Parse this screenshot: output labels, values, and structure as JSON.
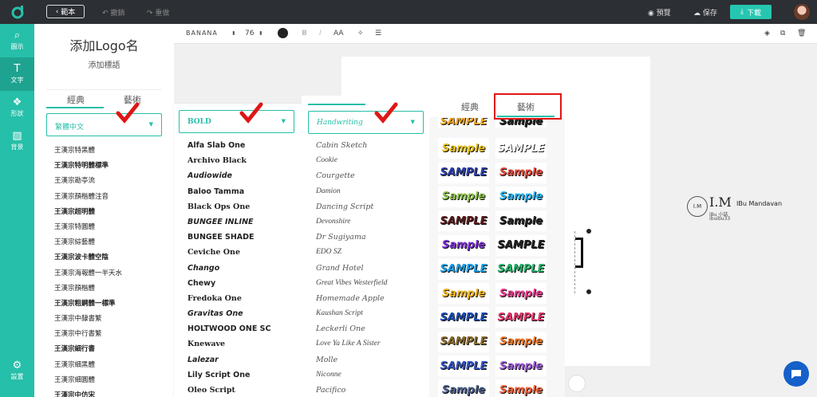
{
  "topbar": {
    "back_label": "範本",
    "undo_label": "撤銷",
    "redo_label": "重做",
    "preview_label": "預覽",
    "save_label": "保存",
    "download_label": "下載"
  },
  "sidebar": {
    "items": [
      {
        "label": "圖示",
        "icon": "search-icon"
      },
      {
        "label": "文字",
        "icon": "text-icon"
      },
      {
        "label": "形狀",
        "icon": "shapes-icon"
      },
      {
        "label": "背景",
        "icon": "pattern-icon"
      },
      {
        "label": "設置",
        "icon": "gear-icon"
      }
    ]
  },
  "text_panel": {
    "title": "添加Logo名",
    "subtitle": "添加標語",
    "tabs": [
      "經典",
      "藝術"
    ],
    "select_value": "繁體中文",
    "fonts": [
      "王漢宗特黑體",
      "王漢宗特明體標準",
      "王漢宗勘亭流",
      "王漢宗顏楷體注音",
      "王漢宗超明體",
      "王漢宗特圓體",
      "王漢宗綜藝體",
      "王漢宗波卡體空陰",
      "王漢宗海報體一半天水",
      "王漢宗顏楷體",
      "王漢宗粗鋼體一標準",
      "王漢宗中隸書繁",
      "王漢宗中行書繁",
      "王漢宗細行書",
      "王漢宗細黑體",
      "王漢宗細圓體",
      "王漢宗中仿宋"
    ]
  },
  "toolbar": {
    "font_name": "BANANA",
    "font_size": "76",
    "bold": "B",
    "italic": "I",
    "case": "AA"
  },
  "panel_bold": {
    "select_value": "BOLD",
    "fonts": [
      "Alfa Slab One",
      "Archivo Black",
      "Audiowide",
      "Baloo Tamma",
      "Black Ops One",
      "BUNGEE INLINE",
      "BUNGEE SHADE",
      "Ceviche One",
      "Chango",
      "Chewy",
      "Fredoka One",
      "Gravitas One",
      "HOLTWOOD ONE SC",
      "Knewave",
      "Lalezar",
      "Lily Script One",
      "Oleo Script"
    ]
  },
  "panel_hand": {
    "select_value": "Handwriting",
    "fonts": [
      "Cabin Sketch",
      "Cookie",
      "Courgette",
      "Damion",
      "Dancing Script",
      "Devonshire",
      "Dr Sugiyama",
      "EDO SZ",
      "Grand Hotel",
      "Great Vibes Westerfield",
      "Homemade Apple",
      "Kaushan Script",
      "Leckerli One",
      "Love Ya Like A Sister",
      "Molle",
      "Niconne",
      "Pacifico"
    ]
  },
  "panel_art": {
    "tabs": [
      "經典",
      "藝術"
    ],
    "sample_text": "Sample",
    "sample_text_upper": "SAMPLE"
  },
  "watermark": {
    "initials": "I.M",
    "name": "IBu Mandavan",
    "line1": "iBu 小誌",
    "line2": "ibuibu33"
  },
  "colors": {
    "accent": "#26bfa9",
    "topbar": "#2c2f33",
    "highlight": "#e01515",
    "chat": "#1560c9"
  }
}
